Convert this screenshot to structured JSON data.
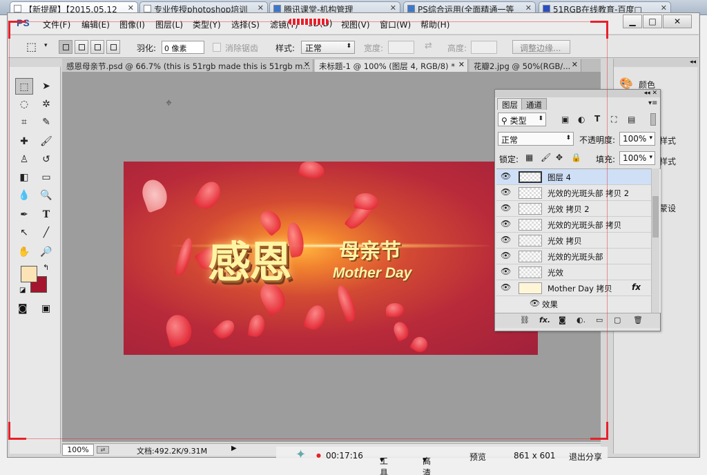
{
  "browser_tabs": [
    {
      "title": "【新提醒】【2015.05.12",
      "active": true
    },
    {
      "title": "专业传授photoshop培训",
      "active": false
    },
    {
      "title": "腾讯课堂-机构管理",
      "active": false
    },
    {
      "title": "PS综合运用(全面精通一等",
      "active": false
    },
    {
      "title": "51RGB在线教育-百度□",
      "active": false
    }
  ],
  "ps": {
    "logo": "PS",
    "menu": [
      "文件(F)",
      "编辑(E)",
      "图像(I)",
      "图层(L)",
      "类型(Y)",
      "选择(S)",
      "滤镜(T)",
      "3D(D)",
      "视图(V)",
      "窗口(W)",
      "帮助(H)"
    ],
    "window_controls": [
      "▁",
      "□",
      "✕"
    ]
  },
  "options_bar": {
    "feather_label": "羽化:",
    "feather_value": "0 像素",
    "antialias_label": "消除锯齿",
    "style_label": "样式:",
    "style_value": "正常",
    "width_label": "宽度:",
    "height_label": "高度:",
    "refine_edge_label": "调整边缘..."
  },
  "document_tabs": [
    {
      "title": "感恩母亲节.psd @ 66.7% (this is 51rgb made this is 51rgb m...",
      "active": false
    },
    {
      "title": "未标题-1 @ 100% (图层 4, RGB/8) *",
      "active": true
    },
    {
      "title": "花瓣2.jpg @ 50%(RGB/...",
      "active": false
    }
  ],
  "artwork": {
    "main_text": "感恩",
    "sub_text": "母亲节",
    "english_text": "Mother Day"
  },
  "statusbar": {
    "zoom": "100%",
    "doc_info": "文档:492.2K/9.31M"
  },
  "right_dock": {
    "items": [
      "颜色",
      "样式",
      "样式",
      "蒙设"
    ]
  },
  "layers_panel": {
    "tabs": [
      "图层",
      "通道"
    ],
    "filter_kind": "类型",
    "blend_mode": "正常",
    "opacity_label": "不透明度:",
    "opacity_value": "100%",
    "lock_label": "锁定:",
    "fill_label": "填充:",
    "fill_value": "100%",
    "layers": [
      {
        "name": "图层 4",
        "selected": true
      },
      {
        "name": "光效的光斑头部 拷贝 2",
        "selected": false
      },
      {
        "name": "光效 拷贝 2",
        "selected": false
      },
      {
        "name": "光效的光斑头部 拷贝",
        "selected": false
      },
      {
        "name": "光效 拷贝",
        "selected": false
      },
      {
        "name": "光效的光斑头部",
        "selected": false
      },
      {
        "name": "光效",
        "selected": false
      },
      {
        "name": "Mother Day 拷贝",
        "selected": false,
        "fx": "fx"
      }
    ],
    "effects_label": "效果"
  },
  "bottom_bar": {
    "time": "00:17:16",
    "tools": "工具",
    "quality": "高清",
    "preview": "预览",
    "resolution": "861 x 601",
    "exit": "退出分享"
  },
  "colors": {
    "foreground": "#fbe3b6",
    "background": "#a5152e",
    "frame_red": "#e8202a",
    "selected_layer": "#cfdff6"
  }
}
